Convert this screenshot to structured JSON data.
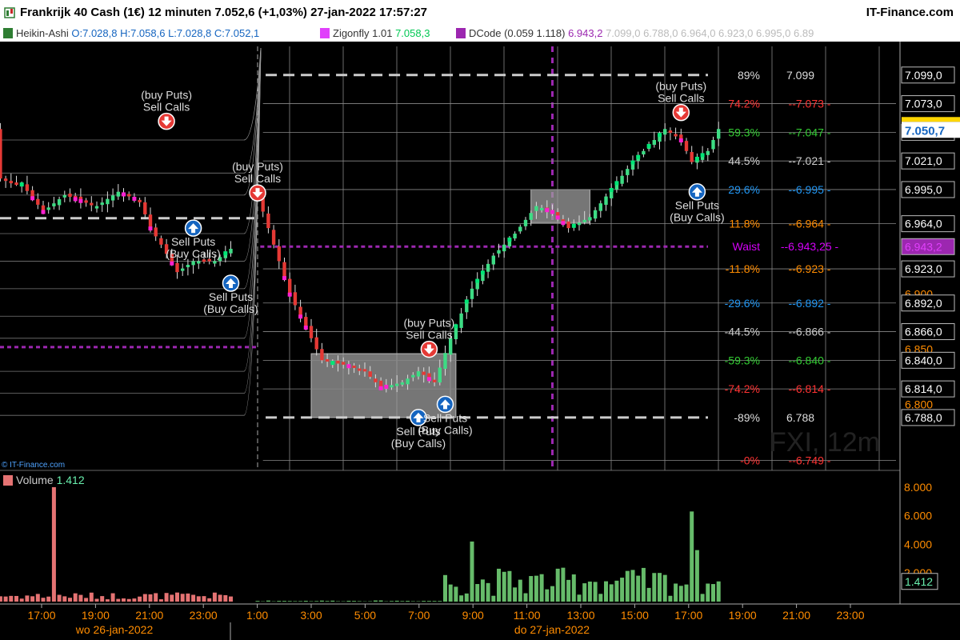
{
  "header": {
    "title": "Frankrijk 40 Cash (1€) 12 minuten 7.052,6 (+1,03%) 27-jan-2022 17:57:27",
    "brand": "IT-Finance.com"
  },
  "indicators": {
    "heikin": {
      "name": "Heikin-Ashi",
      "values": "O:7.028,8 H:7.058,6 L:7.028,8 C:7.052,1",
      "color": "#2e7d32"
    },
    "zigonfly": {
      "name": "Zigonfly 1.01",
      "value": "7.058,3",
      "color": "#e040fb"
    },
    "dcode": {
      "name": "DCode (0.059 1.118)",
      "value": "6.943,2",
      "extra": "7.099,0  6.788,0  6.964,0  6.923,0  6.995,0  6.89",
      "color": "#9c27b0"
    }
  },
  "copyright": "© IT-Finance.com",
  "watermark": "FXI, 12m",
  "volume_legend": {
    "label": "Volume",
    "value": "1.412"
  },
  "colors": {
    "up": "#3ddc84",
    "down": "#e53935",
    "dcode_line": "#9c27b0",
    "grid": "#888888",
    "price_box": "#ffd600"
  },
  "chart_data": {
    "type": "candlestick",
    "title": "Frankrijk 40 Cash (1€) 12 minuten",
    "ylim": [
      6740,
      7125
    ],
    "last_price": "7.050,7",
    "price_axis_labels": [
      "7.099,0",
      "7.073,0",
      "7.047,0",
      "7.021,0",
      "6.995,0",
      "6.964,0",
      "6.943,2",
      "6.923,0",
      "6.900",
      "6.892,0",
      "6.866,0",
      "6.850",
      "6.840,0",
      "6.814,0",
      "6.800",
      "6.788,0"
    ],
    "price_axis_values": [
      7099,
      7073,
      7047,
      7021,
      6995,
      6964,
      6943.2,
      6923,
      6900,
      6892,
      6866,
      6850,
      6840,
      6814,
      6800,
      6788
    ],
    "x_tick_labels": [
      "17:00",
      "19:00",
      "21:00",
      "23:00",
      "1:00",
      "3:00",
      "5:00",
      "7:00",
      "9:00",
      "11:00",
      "13:00",
      "15:00",
      "17:00",
      "19:00",
      "21:00",
      "23:00"
    ],
    "day_labels": [
      "wo 26-jan-2022",
      "do 27-jan-2022"
    ],
    "fib_levels": [
      {
        "pct": "89%",
        "price": "7.099",
        "value": 7099,
        "color": "#dddddd"
      },
      {
        "pct": "74.2%",
        "price": "7.073",
        "value": 7073,
        "color": "#ff3333"
      },
      {
        "pct": "59.3%",
        "price": "7.047",
        "value": 7047,
        "color": "#33cc33"
      },
      {
        "pct": "44.5%",
        "price": "7.021",
        "value": 7021,
        "color": "#cccccc"
      },
      {
        "pct": "29.6%",
        "price": "6.995",
        "value": 6995,
        "color": "#2196f3"
      },
      {
        "pct": "11.8%",
        "price": "6.964",
        "value": 6964,
        "color": "#ff8c00"
      },
      {
        "pct": "Waist",
        "price": "6.943,25",
        "value": 6943.25,
        "color": "#d500f9"
      },
      {
        "pct": "-11.8%",
        "price": "6.923",
        "value": 6923,
        "color": "#ff8c00"
      },
      {
        "pct": "-29.6%",
        "price": "6.892",
        "value": 6892,
        "color": "#2196f3"
      },
      {
        "pct": "-44.5%",
        "price": "6.866",
        "value": 6866,
        "color": "#cccccc"
      },
      {
        "pct": "-59.3%",
        "price": "6.840",
        "value": 6840,
        "color": "#33cc33"
      },
      {
        "pct": "-74.2%",
        "price": "6.814",
        "value": 6814,
        "color": "#ff3333"
      },
      {
        "pct": "-89%",
        "price": "6.788",
        "value": 6788,
        "color": "#dddddd"
      },
      {
        "pct": "-0%",
        "price": "6.749",
        "value": 6749,
        "color": "#ff3333"
      }
    ],
    "signals": [
      {
        "kind": "sell",
        "line1": "(buy Puts)",
        "line2": "Sell Calls",
        "t": -17,
        "price": 7057
      },
      {
        "kind": "buy",
        "line1": "Sell Puts",
        "line2": "(Buy Calls)",
        "t": -12,
        "price": 6960
      },
      {
        "kind": "buy",
        "line1": "Sell Puts",
        "line2": "(Buy Calls)",
        "t": -5,
        "price": 6910
      },
      {
        "kind": "sell",
        "line1": "(buy Puts)",
        "line2": "Sell Calls",
        "t": 0,
        "price": 6992
      },
      {
        "kind": "sell",
        "line1": "(buy Puts)",
        "line2": "Sell Calls",
        "t": 32,
        "price": 6850
      },
      {
        "kind": "buy",
        "line1": "Sell Puts",
        "line2": "(Buy Calls)",
        "t": 30,
        "price": 6788
      },
      {
        "kind": "buy",
        "line1": "Sell Puts",
        "line2": "(Buy Calls)",
        "t": 35,
        "price": 6800
      },
      {
        "kind": "sell",
        "line1": "(buy Puts)",
        "line2": "Sell Calls",
        "t": 79,
        "price": 7065
      },
      {
        "kind": "buy",
        "line1": "Sell Puts",
        "line2": "(Buy Calls)",
        "t": 82,
        "price": 6993
      }
    ],
    "volume_axis": [
      "8.000",
      "6.000",
      "4.000",
      "2.000"
    ],
    "volume_axis_values": [
      8000,
      6000,
      4000,
      2000
    ],
    "volume_last": "1.412"
  }
}
